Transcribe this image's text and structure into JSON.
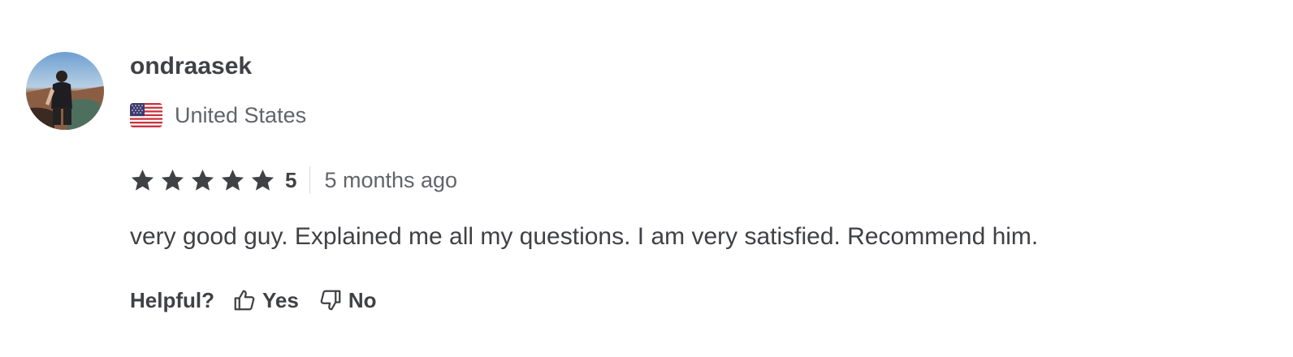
{
  "review": {
    "username": "ondraasek",
    "country": "United States",
    "country_flag_icon": "us-flag-icon",
    "rating": 5,
    "rating_label": "5",
    "rating_max": 5,
    "time_ago": "5 months ago",
    "text": "very good guy. Explained me all my questions. I am very satisfied. Recommend him.",
    "helpful": {
      "label": "Helpful?",
      "yes_label": "Yes",
      "no_label": "No",
      "yes_icon": "thumbs-up-icon",
      "no_icon": "thumbs-down-icon"
    }
  },
  "colors": {
    "text_primary": "#404145",
    "text_secondary": "#62646a",
    "star": "#404145",
    "divider": "#dadbdd"
  }
}
